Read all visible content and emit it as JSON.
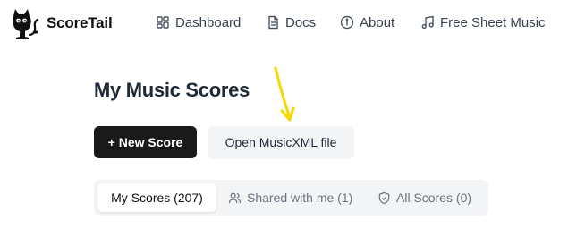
{
  "brand": {
    "name": "ScoreTail",
    "logo_icon": "cat-logo-icon"
  },
  "nav": [
    {
      "label": "Dashboard",
      "icon": "dashboard-icon"
    },
    {
      "label": "Docs",
      "icon": "document-icon"
    },
    {
      "label": "About",
      "icon": "info-icon"
    },
    {
      "label": "Free Sheet Music",
      "icon": "music-note-icon"
    }
  ],
  "main": {
    "title": "My Music Scores",
    "new_score_label": "+ New Score",
    "open_file_label": "Open MusicXML file"
  },
  "tabs": [
    {
      "label": "My Scores (207)",
      "active": true
    },
    {
      "label": "Shared with me (1)",
      "icon": "users-icon",
      "active": false
    },
    {
      "label": "All Scores (0)",
      "icon": "shield-icon",
      "active": false
    }
  ],
  "colors": {
    "primary_button": "#1a1a1a",
    "secondary_button": "#f3f4f6",
    "annotation_arrow": "#f5d90a",
    "text_dark": "#1f2937",
    "text_muted": "#6b7280"
  }
}
